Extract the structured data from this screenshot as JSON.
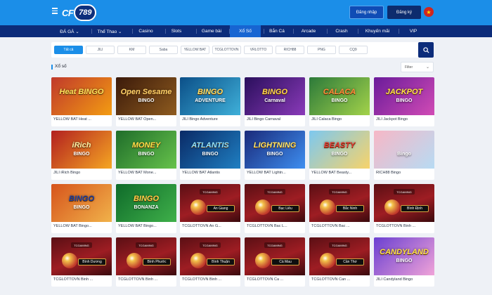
{
  "header": {
    "logo_text": "CF",
    "logo_badge": "789",
    "login_label": "Đăng nhập",
    "register_label": "Đăng ký",
    "language_flag": "★"
  },
  "nav": {
    "items": [
      {
        "label": "ĐÁ GÀ ⌄"
      },
      {
        "label": "Thể Thao ⌄"
      },
      {
        "label": "Casino"
      },
      {
        "label": "Slots"
      },
      {
        "label": "Game bài"
      },
      {
        "label": "Xổ Số"
      },
      {
        "label": "Bắn Cá"
      },
      {
        "label": "Arcade"
      },
      {
        "label": "Crash"
      },
      {
        "label": "Khuyến mãi"
      },
      {
        "label": "VIP"
      }
    ],
    "active": "Xổ Số"
  },
  "filters": {
    "chips": [
      {
        "label": "Tất cả"
      },
      {
        "label": "JILI"
      },
      {
        "label": "KM"
      },
      {
        "label": "Saba"
      },
      {
        "label": "YELLOW BAT"
      },
      {
        "label": "TCGLOTTOVN"
      },
      {
        "label": "VRLOTTO"
      },
      {
        "label": "RICH88"
      },
      {
        "label": "PNG"
      },
      {
        "label": "CQ9"
      }
    ],
    "active": "Tất cả"
  },
  "section": {
    "title": "Xổ số",
    "filter_label": "Filter"
  },
  "games": [
    {
      "name": "YELLOW BAT Heat ...",
      "art_title": "Heat BINGO",
      "art_sub": "",
      "kind": "art"
    },
    {
      "name": "YELLOW BAT Open...",
      "art_title": "Open Sesame",
      "art_sub": "BINGO",
      "kind": "art"
    },
    {
      "name": "JILI Bingo Adventure",
      "art_title": "BINGO",
      "art_sub": "ADVENTURE",
      "kind": "art"
    },
    {
      "name": "JILI Bingo Carnaval",
      "art_title": "BINGO",
      "art_sub": "Carnaval",
      "kind": "art"
    },
    {
      "name": "JILI Calaca Bingo",
      "art_title": "CALACA",
      "art_sub": "BINGO",
      "kind": "art"
    },
    {
      "name": "JILI Jackpot Bingo",
      "art_title": "JACKPOT",
      "art_sub": "BINGO",
      "kind": "art"
    },
    {
      "name": "JILI iRich Bingo",
      "art_title": "iRich",
      "art_sub": "BINGO",
      "kind": "art"
    },
    {
      "name": "YELLOW BAT Mone...",
      "art_title": "MONEY",
      "art_sub": "BINGO",
      "kind": "art"
    },
    {
      "name": "YELLOW BAT Atlantis",
      "art_title": "ATLANTIS",
      "art_sub": "BINGO",
      "kind": "art"
    },
    {
      "name": "YELLOW BAT Lightn...",
      "art_title": "LIGHTNING",
      "art_sub": "BINGO",
      "kind": "art"
    },
    {
      "name": "YELLOW BAT Beasty...",
      "art_title": "BEASTY",
      "art_sub": "BINGO",
      "kind": "art"
    },
    {
      "name": "RICH88 Bingo",
      "art_title": "",
      "art_sub": "Bingo",
      "kind": "art"
    },
    {
      "name": "YELLOW BAT Bingo...",
      "art_title": "BINGO",
      "art_sub": "BINGO",
      "kind": "art"
    },
    {
      "name": "YELLOW BAT Bingo...",
      "art_title": "BINGO",
      "art_sub": "BONANZA",
      "kind": "art"
    },
    {
      "name": "TCGLOTTOVN An G...",
      "plate": "An Giang",
      "kind": "tcg"
    },
    {
      "name": "TCGLOTTOVN Bac L...",
      "plate": "Bạc Liêu",
      "kind": "tcg"
    },
    {
      "name": "TCGLOTTOVN Bac ...",
      "plate": "Bắc Ninh",
      "kind": "tcg"
    },
    {
      "name": "TCGLOTTOVN Binh ...",
      "plate": "Bình Định",
      "kind": "tcg"
    },
    {
      "name": "TCGLOTTOVN Binh ...",
      "plate": "Bình Dương",
      "kind": "tcg"
    },
    {
      "name": "TCGLOTTOVN Binh ...",
      "plate": "Bình Phước",
      "kind": "tcg"
    },
    {
      "name": "TCGLOTTOVN Binh ...",
      "plate": "Bình Thuận",
      "kind": "tcg"
    },
    {
      "name": "TCGLOTTOVN Ca ...",
      "plate": "Cà Mau",
      "kind": "tcg"
    },
    {
      "name": "TCGLOTTOVN Can ...",
      "plate": "Cần Thơ",
      "kind": "tcg"
    },
    {
      "name": "JILI Candyland Bingo",
      "art_title": "CANDYLAND",
      "art_sub": "BINGO",
      "kind": "art"
    }
  ],
  "tcg_logo": "TCGAMING"
}
